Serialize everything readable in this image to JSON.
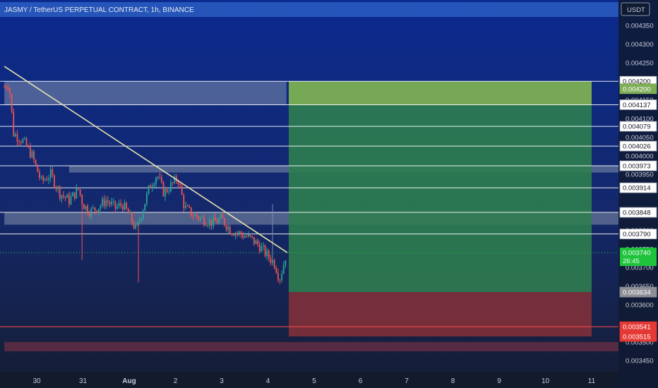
{
  "header": {
    "title": "JASMY / TetherUS PERPETUAL CONTRACT, 1h, BINANCE",
    "currency_button": "USDT"
  },
  "colors": {
    "background_top": "#0a2a8f",
    "background_bottom": "#151d33",
    "candle_up": "#26a69a",
    "candle_down": "#ef5350",
    "profit_zone": "#2e7d4f",
    "profit_zone_top": "#7fae57",
    "loss_zone": "#7a2f3a",
    "trendline": "#e8e2b0",
    "level_line": "#ffffff",
    "current_price": "#1fc33c",
    "stop_line": "#ff4a4a"
  },
  "chart_data": {
    "type": "candlestick",
    "title": "JASMY / TetherUS PERPETUAL CONTRACT, 1h, BINANCE",
    "ylim": [
      0.00343,
      0.00438
    ],
    "y_ticks": [
      "0.004350",
      "0.004300",
      "0.004250",
      "0.004150",
      "0.004100",
      "0.004050",
      "0.004000",
      "0.003950",
      "0.003850",
      "0.003800",
      "0.003750",
      "0.003700",
      "0.003650",
      "0.003600",
      "0.003500",
      "0.003450"
    ],
    "x_ticks": [
      {
        "label": "30",
        "x": -4.5
      },
      {
        "label": "31",
        "x": -3.5
      },
      {
        "label": "Aug",
        "x": -2.5
      },
      {
        "label": "2",
        "x": -1.5
      },
      {
        "label": "3",
        "x": -0.5
      },
      {
        "label": "4",
        "x": 0.5
      },
      {
        "label": "5",
        "x": 1.5
      },
      {
        "label": "6",
        "x": 2.5
      },
      {
        "label": "7",
        "x": 3.5
      },
      {
        "label": "8",
        "x": 4.5
      },
      {
        "label": "9",
        "x": 5.5
      },
      {
        "label": "10",
        "x": 6.5
      },
      {
        "label": "11",
        "x": 7.5
      }
    ],
    "x_range": [
      -5.2,
      8.5
    ],
    "price_path": [
      [
        -5.2,
        0.004185
      ],
      [
        -5.1,
        0.004195
      ],
      [
        -5.0,
        0.00406
      ],
      [
        -4.8,
        0.00404
      ],
      [
        -4.6,
        0.004
      ],
      [
        -4.4,
        0.00393
      ],
      [
        -4.2,
        0.00395
      ],
      [
        -4.0,
        0.0039
      ],
      [
        -3.8,
        0.00388
      ],
      [
        -3.6,
        0.00391
      ],
      [
        -3.5,
        0.00387
      ],
      [
        -3.35,
        0.00385
      ],
      [
        -3.2,
        0.00386
      ],
      [
        -3.0,
        0.00388
      ],
      [
        -2.8,
        0.00386
      ],
      [
        -2.65,
        0.00387
      ],
      [
        -2.5,
        0.00384
      ],
      [
        -2.35,
        0.0038
      ],
      [
        -2.2,
        0.00386
      ],
      [
        -2.05,
        0.00392
      ],
      [
        -1.9,
        0.00395
      ],
      [
        -1.75,
        0.0039
      ],
      [
        -1.6,
        0.00392
      ],
      [
        -1.45,
        0.00394
      ],
      [
        -1.3,
        0.00386
      ],
      [
        -1.1,
        0.00384
      ],
      [
        -0.9,
        0.00383
      ],
      [
        -0.7,
        0.00382
      ],
      [
        -0.5,
        0.00383
      ],
      [
        -0.3,
        0.0038
      ],
      [
        -0.1,
        0.00379
      ],
      [
        0.1,
        0.00378
      ],
      [
        0.3,
        0.00376
      ],
      [
        0.5,
        0.00373
      ],
      [
        0.65,
        0.00371
      ],
      [
        0.75,
        0.00367
      ],
      [
        0.82,
        0.0037
      ],
      [
        0.9,
        0.00374
      ]
    ],
    "wicks": [
      {
        "x": -3.52,
        "low": 0.00372
      },
      {
        "x": -2.3,
        "low": 0.00366
      },
      {
        "x": 0.6,
        "high": 0.00387
      }
    ],
    "trendline": {
      "from": [
        -5.2,
        0.00424
      ],
      "to": [
        0.92,
        0.00374
      ]
    },
    "levels": [
      0.0042,
      0.004137,
      0.004079,
      0.004026,
      0.003973,
      0.003914,
      0.003848,
      0.00379
    ],
    "zones": [
      {
        "y_top": 0.0042,
        "y_bottom": 0.004137,
        "x_from": -5.2,
        "x_to": 0.9,
        "kind": "resistance"
      },
      {
        "y_top": 0.003973,
        "y_bottom": 0.003955,
        "x_from": -3.8,
        "x_to": 8.5,
        "kind": "resistance"
      },
      {
        "y_top": 0.003848,
        "y_bottom": 0.003815,
        "x_from": -5.2,
        "x_to": 8.5,
        "kind": "resistance"
      },
      {
        "y_top": 0.0035,
        "y_bottom": 0.003475,
        "x_from": -5.2,
        "x_to": 8.5,
        "kind": "support"
      }
    ],
    "position": {
      "x_from": 0.95,
      "x_to": 7.5,
      "take_profit": 0.0042,
      "entry": 0.003634,
      "stop": 0.003515
    },
    "price_tags": [
      {
        "label": "0.004200",
        "y": 0.0042,
        "style": "white"
      },
      {
        "label": "0.004200",
        "y": 0.00418,
        "style": "green"
      },
      {
        "label": "0.004137",
        "y": 0.004137,
        "style": "white"
      },
      {
        "label": "0.004079",
        "y": 0.004079,
        "style": "white"
      },
      {
        "label": "0.004026",
        "y": 0.004026,
        "style": "white"
      },
      {
        "label": "0.003973",
        "y": 0.003973,
        "style": "white"
      },
      {
        "label": "0.003914",
        "y": 0.003914,
        "style": "white"
      },
      {
        "label": "0.003848",
        "y": 0.003848,
        "style": "white"
      },
      {
        "label": "0.003790",
        "y": 0.00379,
        "style": "white"
      },
      {
        "label": "0.003634",
        "y": 0.003634,
        "style": "gray"
      },
      {
        "label": "0.003541",
        "y": 0.003541,
        "style": "red"
      },
      {
        "label": "0.003515",
        "y": 0.003515,
        "style": "red"
      }
    ],
    "current_price": {
      "label": "0.003740",
      "countdown": "26:45",
      "value": 0.00374
    },
    "stop_line": 0.003541
  }
}
